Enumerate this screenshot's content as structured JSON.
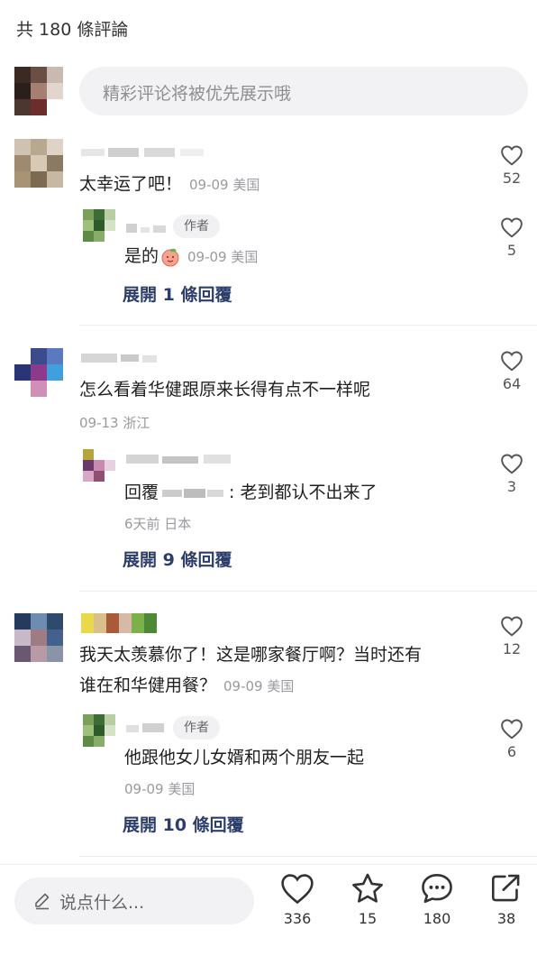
{
  "header": {
    "title": "共 180 條評論"
  },
  "composer": {
    "placeholder": "精彩评论将被优先展示哦"
  },
  "author_tag": "作者",
  "threads": [
    {
      "comment": {
        "text": "太幸运了吧！",
        "meta": "09-09 美国",
        "likes": "52"
      },
      "reply": {
        "text": "是的",
        "meta": "09-09 美国",
        "likes": "5"
      },
      "expand": "展開 1 條回覆"
    },
    {
      "comment": {
        "text": "怎么看着华健跟原来长得有点不一样呢",
        "meta": "09-13 浙江",
        "likes": "64"
      },
      "reply": {
        "prefix": "回覆",
        "text": ": 老到都认不出来了",
        "meta": "6天前 日本",
        "likes": "3"
      },
      "expand": "展開 9 條回覆"
    },
    {
      "comment": {
        "text_line1": "我天太羡慕你了！这是哪家餐厅啊？当时还有",
        "text_line2": "谁在和华健用餐？",
        "meta": "09-09 美国",
        "likes": "12"
      },
      "reply": {
        "text": "他跟他女儿女婿和两个朋友一起",
        "meta": "09-09 美国",
        "likes": "6"
      },
      "expand": "展開 10 條回覆"
    }
  ],
  "bottom_bar": {
    "input_label": "说点什么...",
    "likes": "336",
    "favorites": "15",
    "comments": "180",
    "shares": "38"
  },
  "colors": {
    "link": "#2c3e69",
    "meta": "#9a9a9f",
    "surface": "#f2f2f4"
  },
  "icons": [
    "heart-icon",
    "star-icon",
    "chat-bubble-icon",
    "share-icon",
    "pencil-icon"
  ]
}
